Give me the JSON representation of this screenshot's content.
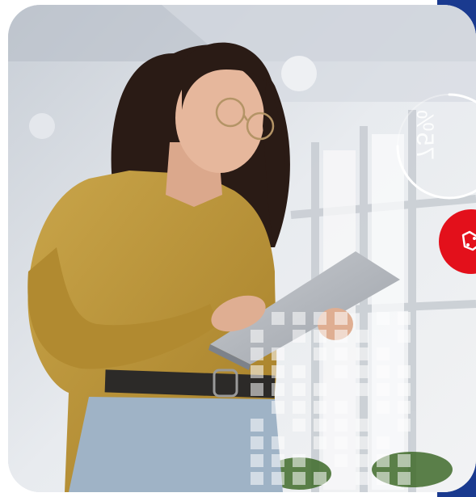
{
  "progress_ring": {
    "value_text": "75%",
    "percent": 75
  },
  "colors": {
    "accent_red": "#e3101b",
    "frame_blue": "#1a3a8f",
    "shirt": "#b79235",
    "jeans": "#9fb3c6"
  },
  "badge": {
    "icon": "car-icon"
  }
}
